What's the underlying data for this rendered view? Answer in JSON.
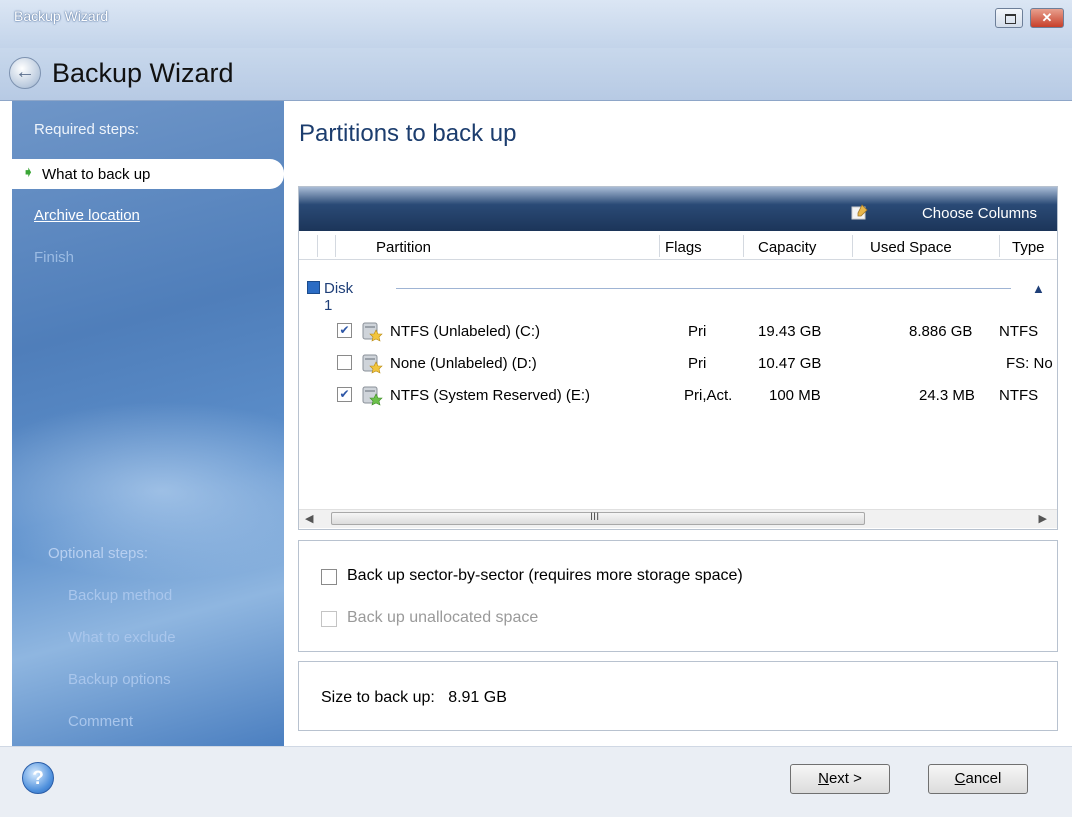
{
  "window": {
    "title": "Backup Wizard",
    "close_glyph": "✕"
  },
  "header": {
    "title": "Backup Wizard",
    "back_icon": "back-arrow-icon"
  },
  "sidebar": {
    "required_heading": "Required steps:",
    "required_steps": [
      {
        "label": "What to back up",
        "state": "current"
      },
      {
        "label": "Archive location",
        "state": "link"
      },
      {
        "label": "Finish",
        "state": "disabled"
      }
    ],
    "optional_heading": "Optional steps:",
    "optional_steps": [
      "Backup method",
      "What to exclude",
      "Backup options",
      "Comment"
    ]
  },
  "main": {
    "title": "Partitions to back up",
    "toolbar": {
      "choose_columns": "Choose Columns"
    },
    "columns": [
      "Partition",
      "Flags",
      "Capacity",
      "Used Space",
      "Type"
    ],
    "disk": {
      "label": "Disk 1"
    },
    "partitions": [
      {
        "checked": true,
        "name": "NTFS (Unlabeled) (C:)",
        "flags": "Pri",
        "capacity": "19.43 GB",
        "used": "8.886 GB",
        "type": "NTFS"
      },
      {
        "checked": false,
        "name": "None (Unlabeled) (D:)",
        "flags": "Pri",
        "capacity": "10.47 GB",
        "used": "",
        "type": "FS: No"
      },
      {
        "checked": true,
        "name": "NTFS (System Reserved) (E:)",
        "flags": "Pri,Act.",
        "capacity": "100 MB",
        "used": "24.3 MB",
        "type": "NTFS"
      }
    ],
    "scroll_grip": "III",
    "options": {
      "sector_by_sector": {
        "label": "Back up sector-by-sector (requires more storage space)",
        "checked": false,
        "enabled": true
      },
      "unallocated": {
        "label": "Back up unallocated space",
        "checked": false,
        "enabled": false
      }
    },
    "size": {
      "label": "Size to back up:",
      "value": "8.91 GB"
    }
  },
  "footer": {
    "help_glyph": "?",
    "next": {
      "mnemonic": "N",
      "rest": "ext >"
    },
    "cancel": {
      "mnemonic": "C",
      "rest": "ancel"
    }
  },
  "colors": {
    "accent": "#1c3d6e",
    "sidebar": "#4f7eba",
    "checkbox_mark": "#2d56a6"
  }
}
